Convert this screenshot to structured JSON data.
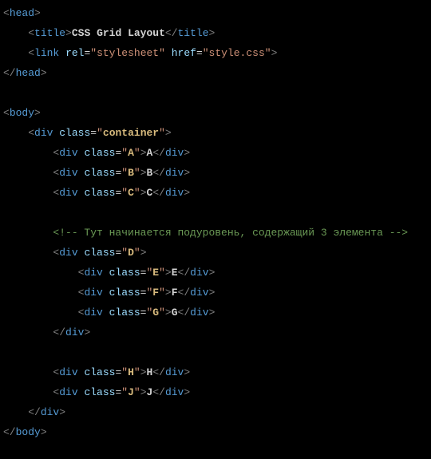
{
  "lines": {
    "l1": {
      "tag": "head"
    },
    "l2": {
      "tag": "title",
      "text": "CSS Grid Layout"
    },
    "l3": {
      "tag": "link",
      "attr1_name": "rel",
      "attr1_val": "\"stylesheet\"",
      "attr2_name": "href",
      "attr2_val": "\"style.css\""
    },
    "l4": {
      "tag": "head"
    },
    "l5": {
      "tag": "body"
    },
    "l6": {
      "tag": "div",
      "attr_name": "class",
      "attr_val": "container"
    },
    "l7": {
      "tag": "div",
      "attr_name": "class",
      "attr_val": "A",
      "text": "A"
    },
    "l8": {
      "tag": "div",
      "attr_name": "class",
      "attr_val": "B",
      "text": "B"
    },
    "l9": {
      "tag": "div",
      "attr_name": "class",
      "attr_val": "C",
      "text": "C"
    },
    "l10": {
      "comment": "<!-- Тут начинается подуровень, содержащий 3 элемента -->"
    },
    "l11": {
      "tag": "div",
      "attr_name": "class",
      "attr_val": "D"
    },
    "l12": {
      "tag": "div",
      "attr_name": "class",
      "attr_val": "E",
      "text": "E"
    },
    "l13": {
      "tag": "div",
      "attr_name": "class",
      "attr_val": "F",
      "text": "F"
    },
    "l14": {
      "tag": "div",
      "attr_name": "class",
      "attr_val": "G",
      "text": "G"
    },
    "l15": {
      "tag": "div"
    },
    "l16": {
      "tag": "div",
      "attr_name": "class",
      "attr_val": "H",
      "text": "H"
    },
    "l17": {
      "tag": "div",
      "attr_name": "class",
      "attr_val": "J",
      "text": "J"
    },
    "l18": {
      "tag": "div"
    },
    "l19": {
      "tag": "body"
    }
  }
}
